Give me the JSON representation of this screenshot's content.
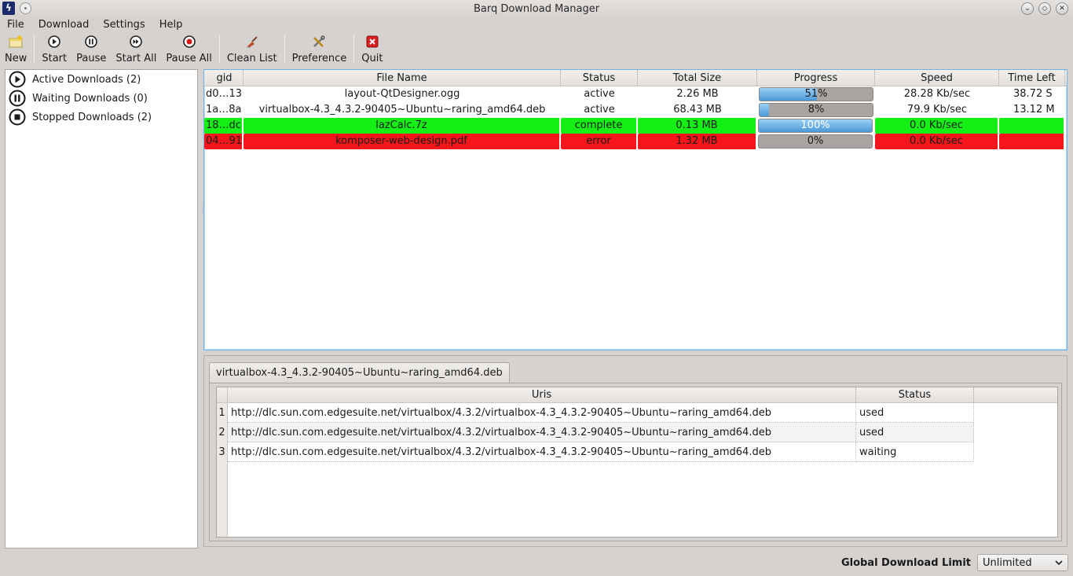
{
  "window": {
    "title": "Barq Download Manager"
  },
  "menu": [
    "File",
    "Download",
    "Settings",
    "Help"
  ],
  "toolbar": {
    "new": "New",
    "start": "Start",
    "pause": "Pause",
    "start_all": "Start All",
    "pause_all": "Pause All",
    "clean_list": "Clean List",
    "preference": "Preference",
    "quit": "Quit"
  },
  "sidebar": {
    "items": [
      {
        "label": "Active Downloads (2)",
        "icon": "play-icon"
      },
      {
        "label": "Waiting Downloads (0)",
        "icon": "pause-icon"
      },
      {
        "label": "Stopped Downloads (2)",
        "icon": "stop-icon"
      }
    ]
  },
  "downloads": {
    "columns": [
      "gid",
      "File Name",
      "Status",
      "Total Size",
      "Progress",
      "Speed",
      "Time Left"
    ],
    "rows": [
      {
        "gid": "d0…13",
        "file": "layout-QtDesigner.ogg",
        "status": "active",
        "size": "2.26 MB",
        "progress": 51,
        "progress_label": "51%",
        "speed": "28.28 Kb/sec",
        "time_left": "38.72  S",
        "color": "none"
      },
      {
        "gid": "1a…8a",
        "file": "virtualbox-4.3_4.3.2-90405~Ubuntu~raring_amd64.deb",
        "status": "active",
        "size": "68.43 MB",
        "progress": 8,
        "progress_label": "8%",
        "speed": "79.9 Kb/sec",
        "time_left": "13.12  M",
        "color": "none"
      },
      {
        "gid": "18…dc",
        "file": "lazCalc.7z",
        "status": "complete",
        "size": "0.13 MB",
        "progress": 100,
        "progress_label": "100%",
        "speed": "0.0 Kb/sec",
        "time_left": "",
        "color": "#14f014"
      },
      {
        "gid": "04…91",
        "file": "komposer-web-design.pdf",
        "status": "error",
        "size": "1.32 MB",
        "progress": 0,
        "progress_label": "0%",
        "speed": "0.0 Kb/sec",
        "time_left": "",
        "color": "#f5151a"
      }
    ]
  },
  "details": {
    "tab": "virtualbox-4.3_4.3.2-90405~Ubuntu~raring_amd64.deb",
    "columns": [
      "Uris",
      "Status"
    ],
    "rows": [
      {
        "num": "1",
        "uri": "http://dlc.sun.com.edgesuite.net/virtualbox/4.3.2/virtualbox-4.3_4.3.2-90405~Ubuntu~raring_amd64.deb",
        "status": "used"
      },
      {
        "num": "2",
        "uri": "http://dlc.sun.com.edgesuite.net/virtualbox/4.3.2/virtualbox-4.3_4.3.2-90405~Ubuntu~raring_amd64.deb",
        "status": "used"
      },
      {
        "num": "3",
        "uri": "http://dlc.sun.com.edgesuite.net/virtualbox/4.3.2/virtualbox-4.3_4.3.2-90405~Ubuntu~raring_amd64.deb",
        "status": "waiting"
      }
    ]
  },
  "statusbar": {
    "limit_label": "Global Download Limit",
    "limit_value": "Unlimited"
  },
  "colors": {
    "complete": "#14f014",
    "error": "#f5151a",
    "progress": "#4a98d8",
    "focus_border": "#6fb3e8"
  }
}
